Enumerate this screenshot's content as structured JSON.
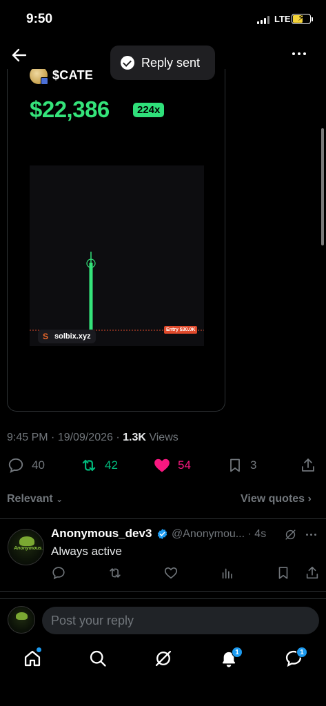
{
  "status_bar": {
    "time": "9:50",
    "network": "LTE"
  },
  "toast": {
    "text": "Reply sent"
  },
  "card": {
    "token": "$CATE",
    "price": "$22,386",
    "multiplier": "224x",
    "brand": "solbix.xyz",
    "entry_label": "Entry $30.0K",
    "brand_color": "#34e37a"
  },
  "post_meta": {
    "time": "9:45 PM",
    "date": "19/09/2026",
    "views_count": "1.3K",
    "views_label": "Views"
  },
  "actions": {
    "replies": "40",
    "reposts": "42",
    "likes": "54",
    "bookmarks": "3"
  },
  "replies_header": {
    "sort": "Relevant",
    "quotes": "View quotes"
  },
  "reply": {
    "name": "Anonymous_dev3",
    "handle": "@Anonymou...",
    "age": "4s",
    "text": "Always active"
  },
  "composer": {
    "placeholder": "Post your reply"
  },
  "tabbar": {
    "notifications_badge": "1",
    "messages_badge": "1"
  },
  "colors": {
    "accent": "#1d9bf0",
    "repost": "#00ba7c",
    "like": "#f91880",
    "muted": "#71767b"
  }
}
